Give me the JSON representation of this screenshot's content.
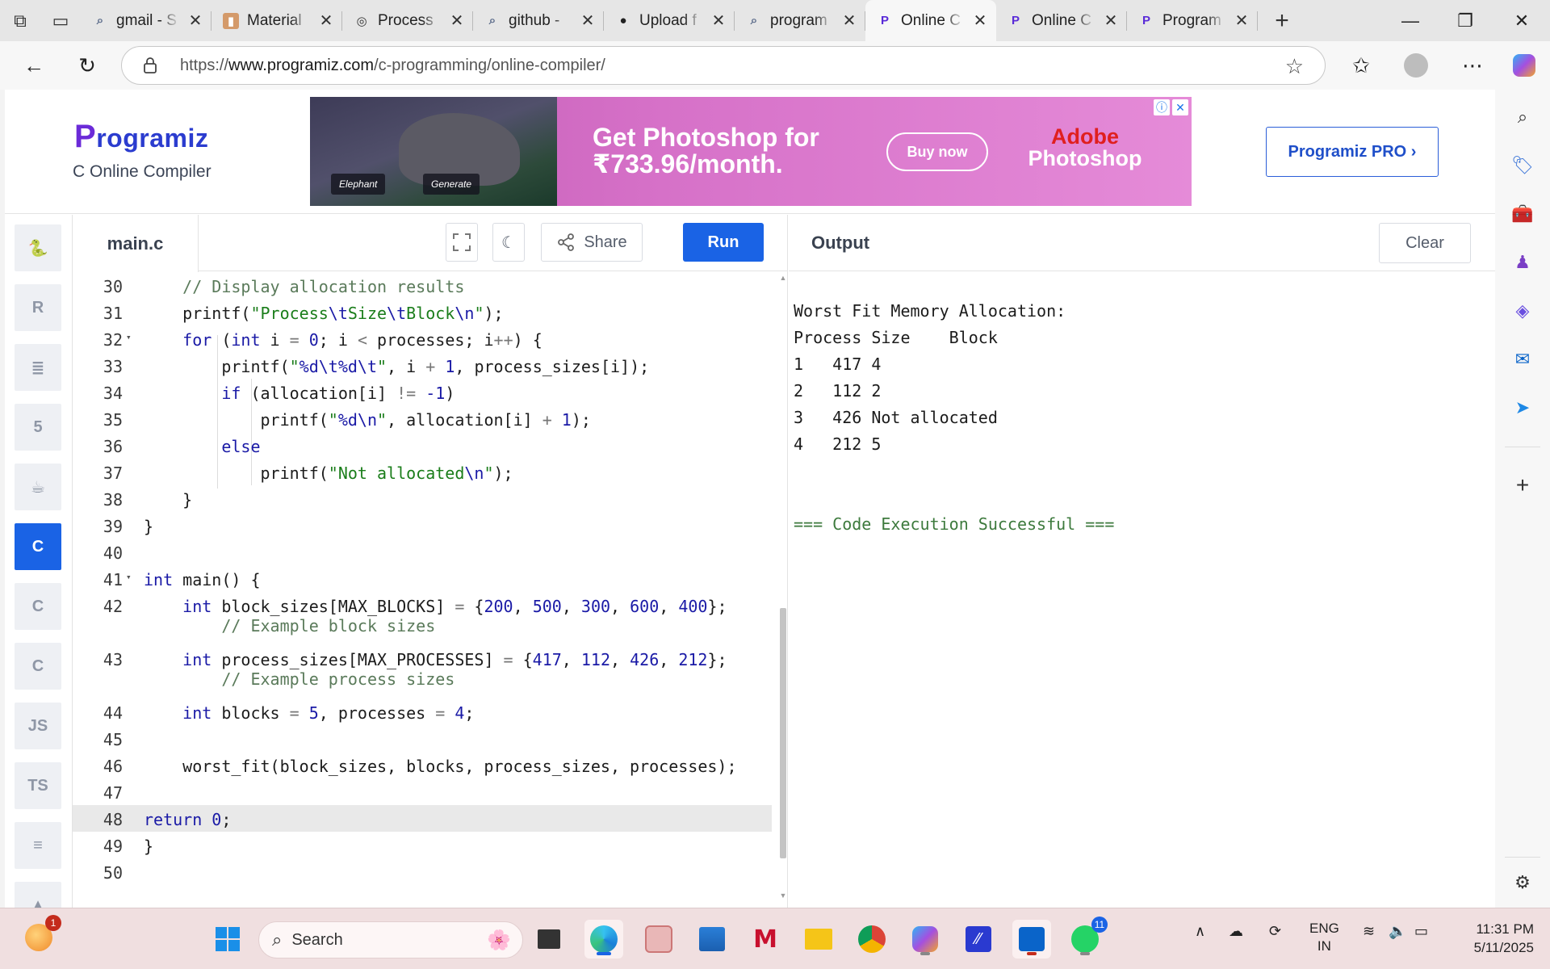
{
  "browser": {
    "tabs": [
      {
        "label": "gmail - S",
        "icon": "search-icon"
      },
      {
        "label": "Material",
        "icon": "material-icon"
      },
      {
        "label": "Process",
        "icon": "openai-icon"
      },
      {
        "label": "github -",
        "icon": "search-icon"
      },
      {
        "label": "Upload f",
        "icon": "github-icon"
      },
      {
        "label": "program",
        "icon": "search-icon"
      },
      {
        "label": "Online C",
        "icon": "programiz-icon",
        "active": true
      },
      {
        "label": "Online C",
        "icon": "programiz-icon"
      },
      {
        "label": "Program",
        "icon": "programiz-icon"
      }
    ],
    "url_prefix": "https://",
    "url_domain": "www.programiz.com",
    "url_path": "/c-programming/online-compiler/"
  },
  "site": {
    "logo_p": "P",
    "logo_rest": "rogramiz",
    "subtitle": "C Online Compiler",
    "pro_button": "Programiz PRO ›"
  },
  "ad": {
    "chip_elephant": "Elephant",
    "chip_generate": "Generate",
    "headline_1": "Get Photoshop for",
    "headline_2": "₹733.96/month.",
    "buy": "Buy now",
    "brand_1": "Adobe",
    "brand_2": "Photoshop"
  },
  "languages": [
    {
      "name": "python-icon",
      "glyph": "🐍"
    },
    {
      "name": "r-icon",
      "glyph": "R"
    },
    {
      "name": "sql-icon",
      "glyph": "≣"
    },
    {
      "name": "html-icon",
      "glyph": "5"
    },
    {
      "name": "java-icon",
      "glyph": "☕"
    },
    {
      "name": "c-icon",
      "glyph": "C",
      "active": true
    },
    {
      "name": "cpp-icon",
      "glyph": "C"
    },
    {
      "name": "csharp-icon",
      "glyph": "C"
    },
    {
      "name": "js-icon",
      "glyph": "JS"
    },
    {
      "name": "ts-icon",
      "glyph": "TS"
    },
    {
      "name": "go-icon",
      "glyph": "≡"
    },
    {
      "name": "more-icon",
      "glyph": "▲"
    }
  ],
  "editor": {
    "filename": "main.c",
    "share": "Share",
    "run": "Run"
  },
  "output": {
    "title": "Output",
    "clear": "Clear",
    "lines": [
      "Worst Fit Memory Allocation:",
      "Process Size    Block",
      "1   417 4",
      "2   112 2",
      "3   426 Not allocated",
      "4   212 5",
      "",
      "",
      "=== Code Execution Successful ==="
    ]
  },
  "taskbar": {
    "search": "Search",
    "lang_1": "ENG",
    "lang_2": "IN",
    "time": "11:31 PM",
    "date": "5/11/2025",
    "notif_badge": "1",
    "whatsapp_badge": "11"
  },
  "colors": {
    "accent": "#1a63e5",
    "brand": "#2b3ccf"
  }
}
